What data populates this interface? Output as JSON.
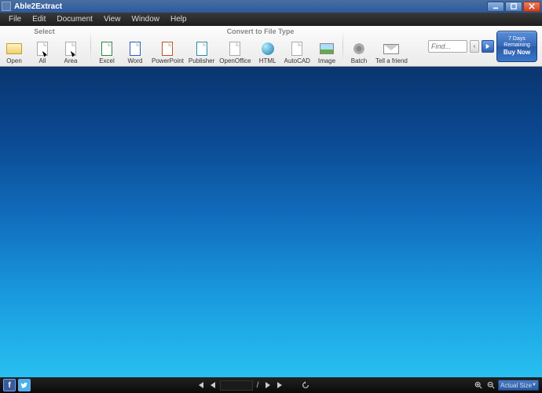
{
  "title": "Able2Extract",
  "menu": [
    "File",
    "Edit",
    "Document",
    "View",
    "Window",
    "Help"
  ],
  "groups": {
    "select": "Select",
    "convert": "Convert to File Type"
  },
  "toolbar": {
    "open": "Open",
    "all": "All",
    "area": "Area",
    "excel": "Excel",
    "word": "Word",
    "ppt": "PowerPoint",
    "publisher": "Publisher",
    "oo": "OpenOffice",
    "html": "HTML",
    "autocad": "AutoCAD",
    "image": "Image",
    "batch": "Batch",
    "tell": "Tell a friend"
  },
  "find": {
    "placeholder": "Find..."
  },
  "trial": {
    "line1": "7 Days",
    "line2": "Remaining",
    "buy": "Buy Now"
  },
  "footer": {
    "page_sep": "/",
    "zoom_label": "Actual Size"
  }
}
